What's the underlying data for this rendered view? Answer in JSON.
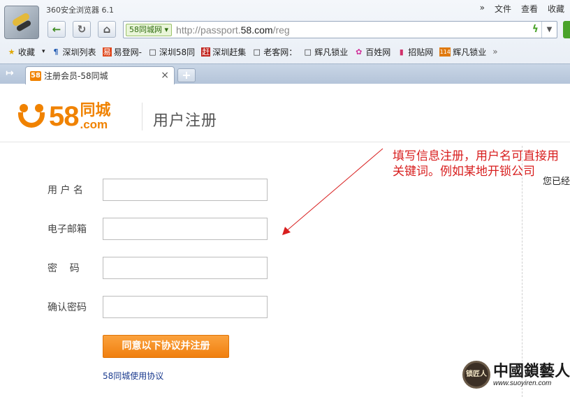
{
  "browser": {
    "title": "360安全浏览器 6.1",
    "menu": [
      "文件",
      "查看",
      "收藏"
    ],
    "menu_more": "»",
    "address": {
      "site_tag": "58同城网",
      "url_prefix": "http://passport.",
      "url_domain": "58.com",
      "url_suffix": "/reg"
    },
    "bookmarks": [
      {
        "label": "收藏",
        "icon": "star-icon"
      },
      {
        "label": "深圳列表",
        "icon": "site-icon"
      },
      {
        "label": "易登网-",
        "icon": "site-icon"
      },
      {
        "label": "深圳58同",
        "icon": "page-icon"
      },
      {
        "label": "深圳赶集",
        "icon": "site-icon"
      },
      {
        "label": "老客网：",
        "icon": "page-icon"
      },
      {
        "label": "辉凡锁业",
        "icon": "page-icon"
      },
      {
        "label": "百姓网",
        "icon": "flower-icon"
      },
      {
        "label": "招贴网",
        "icon": "site-icon"
      },
      {
        "label": "辉凡锁业",
        "icon": "site-icon"
      }
    ],
    "bookmarks_more": "»",
    "tab": {
      "icon_text": "58",
      "label": "注册会员-58同城",
      "close": "×"
    },
    "new_tab": "+"
  },
  "page": {
    "logo": {
      "number": "58",
      "cn": "同城",
      "com": ".com"
    },
    "title": "用户注册",
    "form": {
      "fields": [
        {
          "label": "用 户 名",
          "value": ""
        },
        {
          "label": "电子邮箱",
          "value": ""
        },
        {
          "label": "密    码",
          "value": ""
        },
        {
          "label": "确认密码",
          "value": ""
        }
      ],
      "submit_label": "同意以下协议并注册",
      "terms_link": "58同城使用协议"
    },
    "annotation": "填写信息注册，用户名可直接用关键词。例如某地开锁公司",
    "right_partial_text": "您已经",
    "watermark": {
      "badge": "锁匠人",
      "cn": "中國鎖藝人",
      "url": "www.suoyiren.com"
    },
    "accent_color": "#f08200",
    "annotation_color": "#d81e1e"
  }
}
